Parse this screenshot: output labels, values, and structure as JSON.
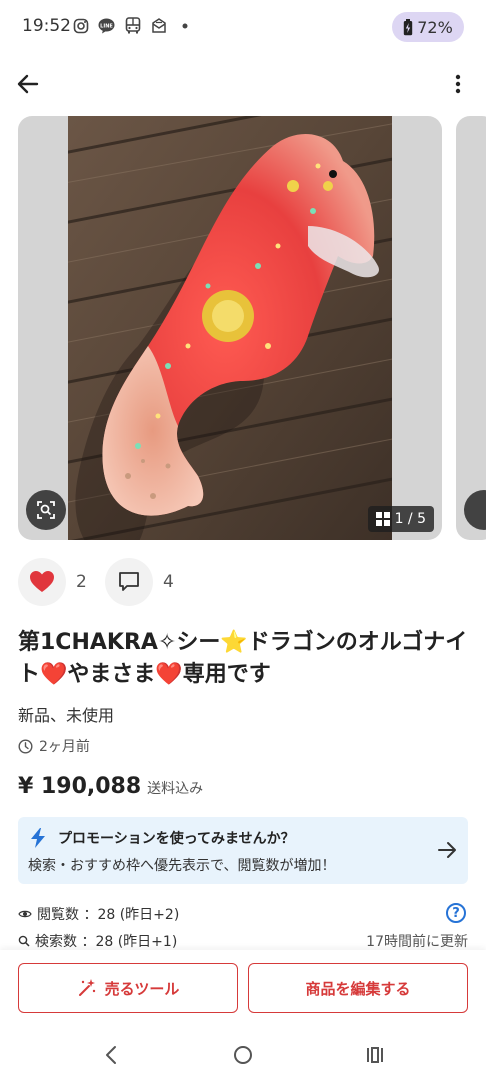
{
  "status_bar": {
    "time": "19:52",
    "battery": "72%",
    "icons": [
      "instagram-icon",
      "line-icon",
      "bus-icon",
      "inbox-icon",
      "dot-icon"
    ]
  },
  "gallery": {
    "counter": "1 / 5"
  },
  "actions": {
    "likes": "2",
    "comments": "4"
  },
  "item": {
    "title": "第1CHAKRA✧シー⭐ドラゴンのオルゴナイト❤️やまさま❤️専用です",
    "condition": "新品、未使用",
    "posted": "2ヶ月前",
    "price": "¥ 190,088",
    "shipping": "送料込み"
  },
  "promo": {
    "title": "プロモーションを使ってみませんか？",
    "description": "検索・おすすめ枠へ優先表示で、閲覧数が増加！"
  },
  "stats": {
    "views": "閲覧数 ：28 (昨日+2)",
    "searches": "検索数 ：28 (昨日+1)",
    "updated": "17時間前に更新"
  },
  "buttons": {
    "sell_tool": "売るツール",
    "edit_item": "商品を編集する"
  },
  "colors": {
    "accent": "#d63a3a",
    "promo_bg": "#e8f3fc",
    "link_blue": "#2673d6",
    "battery_bg": "#ddd6f3"
  }
}
